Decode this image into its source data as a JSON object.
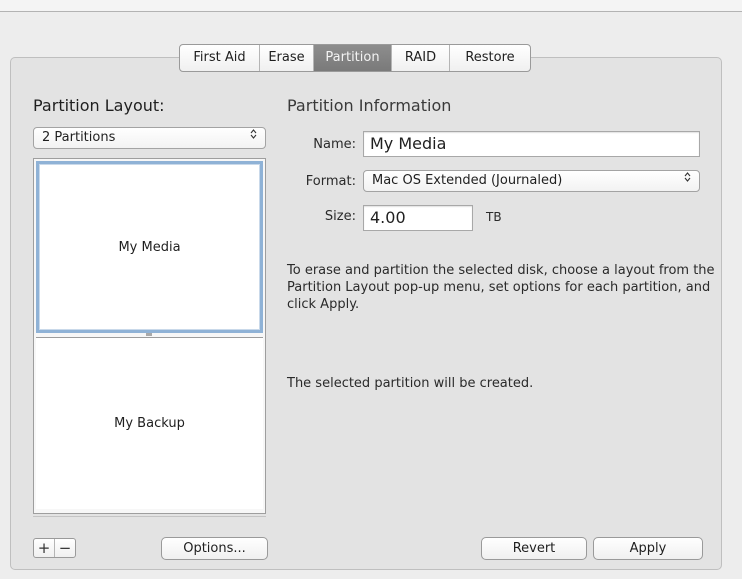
{
  "tabs": [
    "First Aid",
    "Erase",
    "Partition",
    "RAID",
    "Restore"
  ],
  "active_tab": "Partition",
  "layout": {
    "heading": "Partition Layout:",
    "popup_value": "2 Partitions",
    "partitions": [
      "My Media",
      "My Backup"
    ],
    "add_label": "+",
    "remove_label": "−",
    "options_label": "Options..."
  },
  "info": {
    "heading": "Partition Information",
    "name_label": "Name:",
    "name_value": "My Media",
    "format_label": "Format:",
    "format_value": "Mac OS Extended (Journaled)",
    "size_label": "Size:",
    "size_value": "4.00",
    "size_unit": "TB",
    "description": "To erase and partition the selected disk, choose a layout from the Partition Layout pop-up menu, set options for each partition, and click Apply.",
    "status": "The selected partition will be created."
  },
  "buttons": {
    "revert": "Revert",
    "apply": "Apply"
  },
  "popup_arrows": "⌃⌄",
  "colors": {
    "active_tab": "#848484",
    "selection_border": "#8fb2d6"
  }
}
